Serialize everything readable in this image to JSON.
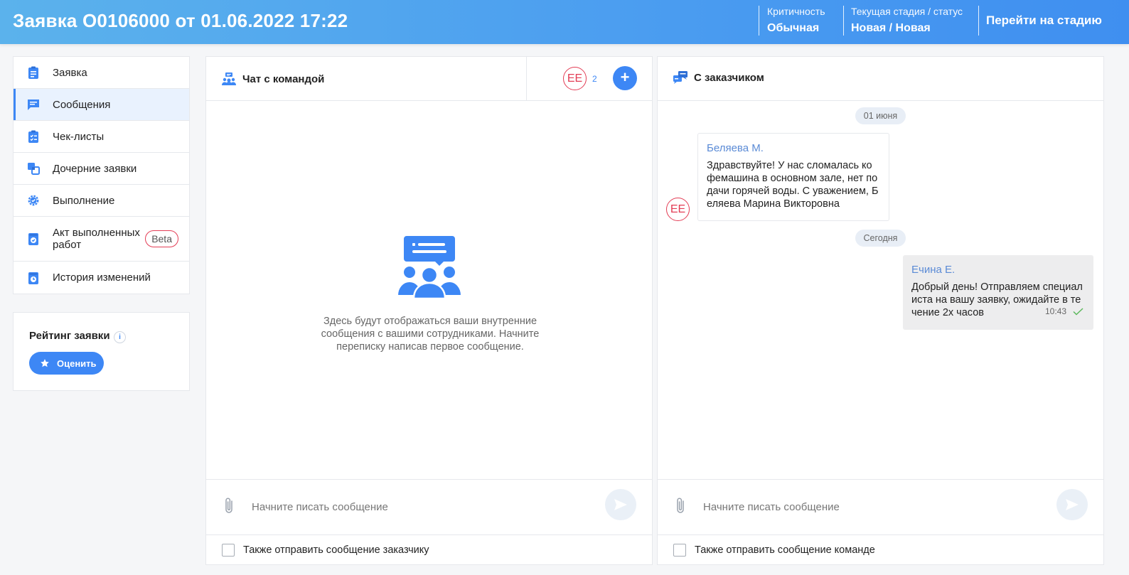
{
  "header": {
    "title": "Заявка О0106000 от 01.06.2022 17:22",
    "criticality_label": "Критичность",
    "criticality_value": "Обычная",
    "stage_label": "Текущая стадия / статус",
    "stage_value": "Новая / Новая",
    "goto_stage": "Перейти на стадию"
  },
  "sidebar": {
    "items": [
      {
        "label": "Заявка",
        "icon": "clipboard-icon"
      },
      {
        "label": "Сообщения",
        "icon": "message-icon",
        "active": true
      },
      {
        "label": "Чек-листы",
        "icon": "checklist-icon"
      },
      {
        "label": "Дочерние заявки",
        "icon": "child-requests-icon"
      },
      {
        "label": "Выполнение",
        "icon": "gear-check-icon"
      },
      {
        "label": "Акт выполненных работ",
        "icon": "act-icon",
        "badge": "Beta"
      },
      {
        "label": "История изменений",
        "icon": "history-icon"
      }
    ]
  },
  "rating": {
    "title": "Рейтинг заявки",
    "info": "i",
    "button": "Оценить"
  },
  "team_chat": {
    "title": "Чат с командой",
    "avatar": "ЕЕ",
    "member_count": "2",
    "add": "+",
    "empty_text": "Здесь будут отображаться ваши внутренние сообщения с вашими сотрудниками. Начните переписку написав первое сообщение.",
    "placeholder": "Начните писать сообщение",
    "checkbox_label": "Также отправить сообщение заказчику"
  },
  "customer_chat": {
    "title": "С заказчиком",
    "date1": "01 июня",
    "msg1_author": "Беляева М.",
    "msg1_text": "Здравствуйте! У нас сломалась ко фемашина в основном зале, нет по дачи горячей воды. С уважением, Б еляева Марина Викторовна",
    "msg1_avatar": "ЕЕ",
    "date2": "Сегодня",
    "msg2_author": "Ечина Е.",
    "msg2_text": "Добрый день! Отправляем специал иста на вашу заявку, ожидайте в те чение 2х часов",
    "msg2_time": "10:43",
    "placeholder": "Начните писать сообщение",
    "checkbox_label": "Также отправить сообщение команде"
  },
  "colors": {
    "accent": "#3d87f5",
    "avatar_border": "#e33d55",
    "header_start": "#5bb2ec",
    "header_end": "#3f8ff0"
  }
}
